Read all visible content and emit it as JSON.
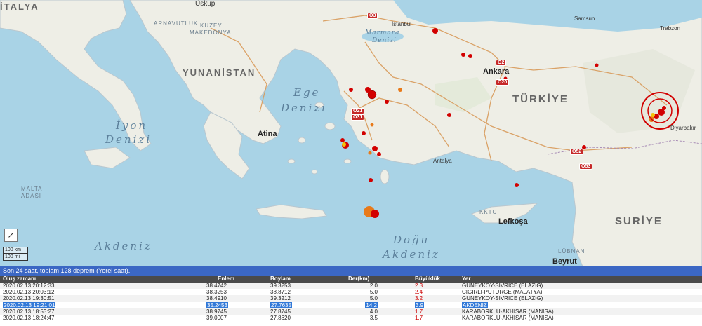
{
  "map": {
    "countries": {
      "italy": "İTALYA",
      "greece": "YUNANİSTAN",
      "turkey": "TÜRKİYE",
      "syria": "SURİYE",
      "north_macedonia_1": "KUZEY",
      "north_macedonia_2": "MAKEDONYA",
      "albania": "ARNAVUTLUK",
      "lebanon": "LÜBNAN",
      "kktc": "KKTC",
      "malta_1": "MALTA",
      "malta_2": "ADASI"
    },
    "seas": {
      "ege_1": "Ege",
      "ege_2": "Denizi",
      "ionian_1": "İyon",
      "ionian_2": "Denizi",
      "med": "Akdeniz",
      "east_med_1": "Doğu",
      "east_med_2": "Akdeniz",
      "marmara_1": "Marmara",
      "marmara_2": "Denizi"
    },
    "cities": {
      "uskup": "Üsküp",
      "istanbul": "İstanbul",
      "ankara": "Ankara",
      "atina": "Atina",
      "samsun": "Samsun",
      "trabzon": "Trabzon",
      "diyarbakir": "Diyarbakır",
      "antalya": "Antalya",
      "lefkosa": "Lefkoşa",
      "beyrut": "Beyrut"
    },
    "highways": {
      "o3": "O3",
      "o2": "O2",
      "o20": "O20",
      "o21": "O21",
      "o31": "O31",
      "o52": "O52",
      "o53": "O53"
    },
    "expand_icon": "expand-arrow-icon",
    "scale": {
      "km": "100 km",
      "mi": "100 mi"
    },
    "colors": {
      "sea": "#a9d3e6",
      "land": "#eeeee6",
      "quake_red": "#d20000",
      "quake_orange": "#e87a1a",
      "quake_yellow": "#f2c20a"
    }
  },
  "panel": {
    "title": "Son 24 saat, toplam 128 deprem (Yerel saat).",
    "columns": {
      "time": "Oluş zamanı",
      "lat": "Enlem",
      "lon": "Boylam",
      "depth": "Der(km)",
      "mag": "Büyüklük",
      "place": "Yer"
    },
    "rows": [
      {
        "time": "2020.02.13 20:12:33",
        "lat": "38.4742",
        "lon": "39.3253",
        "depth": "2.0",
        "mag": "2.3",
        "place": "GUNEYKOY-SIVRICE (ELAZIG)"
      },
      {
        "time": "2020.02.13 20:03:12",
        "lat": "38.3253",
        "lon": "38.8712",
        "depth": "5.0",
        "mag": "2.4",
        "place": "CIGIRLI-PUTURGE (MALATYA)"
      },
      {
        "time": "2020.02.13 19:30:51",
        "lat": "38.4910",
        "lon": "39.3212",
        "depth": "5.0",
        "mag": "3.2",
        "place": "GUNEYKOY-SIVRICE (ELAZIG)"
      },
      {
        "time": "2020.02.13 19:21:01",
        "lat": "35.2453",
        "lon": "27.7635",
        "depth": "14.2",
        "mag": "3.9",
        "place": "AKDENIZ"
      },
      {
        "time": "2020.02.13 18:53:27",
        "lat": "38.9745",
        "lon": "27.8745",
        "depth": "4.0",
        "mag": "1.7",
        "place": "KARABORKLU-AKHISAR (MANISA)"
      },
      {
        "time": "2020.02.13 18:24:47",
        "lat": "39.0007",
        "lon": "27.8620",
        "depth": "3.5",
        "mag": "1.7",
        "place": "KARABORKLU-AKHISAR (MANISA)"
      }
    ]
  }
}
